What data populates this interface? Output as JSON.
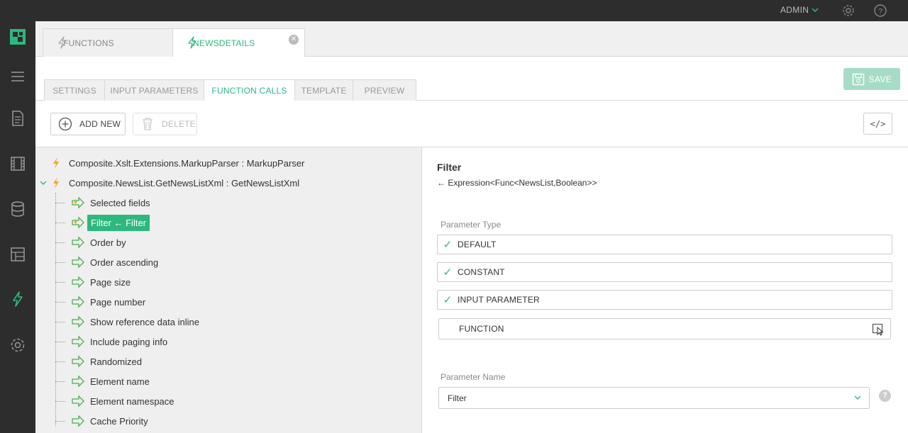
{
  "header": {
    "user_label": "ADMIN",
    "icons": [
      "chevron-down-icon",
      "gear-icon",
      "help-icon"
    ]
  },
  "sidebar": {
    "icons": [
      "logo-icon",
      "menu-icon",
      "content-icon",
      "media-icon",
      "data-icon",
      "layout-icon",
      "functions-icon",
      "system-icon"
    ]
  },
  "top_tabs": [
    {
      "label": "FUNCTIONS",
      "active": false
    },
    {
      "label": "NEWSDETAILS",
      "active": true
    }
  ],
  "sub_tabs": [
    {
      "label": "SETTINGS",
      "active": false
    },
    {
      "label": "INPUT PARAMETERS",
      "active": false
    },
    {
      "label": "FUNCTION CALLS",
      "active": true
    },
    {
      "label": "TEMPLATE",
      "active": false
    },
    {
      "label": "PREVIEW",
      "active": false
    }
  ],
  "toolbar": {
    "save_label": "SAVE",
    "add_new_label": "ADD NEW",
    "delete_label": "DELETE",
    "code_label": "</>"
  },
  "tree": {
    "root_items": [
      {
        "label": "Composite.Xslt.Extensions.MarkupParser : MarkupParser"
      },
      {
        "label": "Composite.NewsList.GetNewsListXml : GetNewsListXml"
      }
    ],
    "params": [
      "Selected fields",
      "Filter ← Filter",
      "Order by",
      "Order ascending",
      "Page size",
      "Page number",
      "Show reference data inline",
      "Include paging info",
      "Randomized",
      "Element name",
      "Element namespace",
      "Cache Priority"
    ]
  },
  "details": {
    "title": "Filter",
    "subtitle": "← Expression<Func<NewsList,Boolean>>",
    "param_type_label": "Parameter Type",
    "options": [
      "DEFAULT",
      "CONSTANT",
      "INPUT PARAMETER",
      "FUNCTION"
    ],
    "param_name_label": "Parameter Name",
    "param_name_value": "Filter",
    "help_label": "?"
  },
  "colors": {
    "accent": "#2db87e",
    "bolt": "#f5a623",
    "dark": "#2d2d2d"
  }
}
